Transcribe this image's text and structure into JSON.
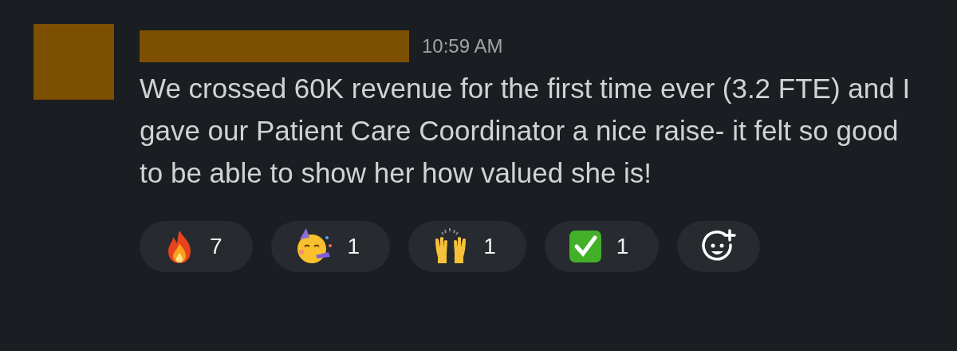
{
  "message": {
    "time": "10:59 AM",
    "text": "We crossed 60K revenue for the first time ever (3.2 FTE) and I gave our Patient Care Coordinator a nice raise- it felt so good to be able to show her how valued she is!"
  },
  "reactions": [
    {
      "kind": "fire",
      "count": "7"
    },
    {
      "kind": "party",
      "count": "1"
    },
    {
      "kind": "hands",
      "count": "1"
    },
    {
      "kind": "check",
      "count": "1"
    }
  ]
}
